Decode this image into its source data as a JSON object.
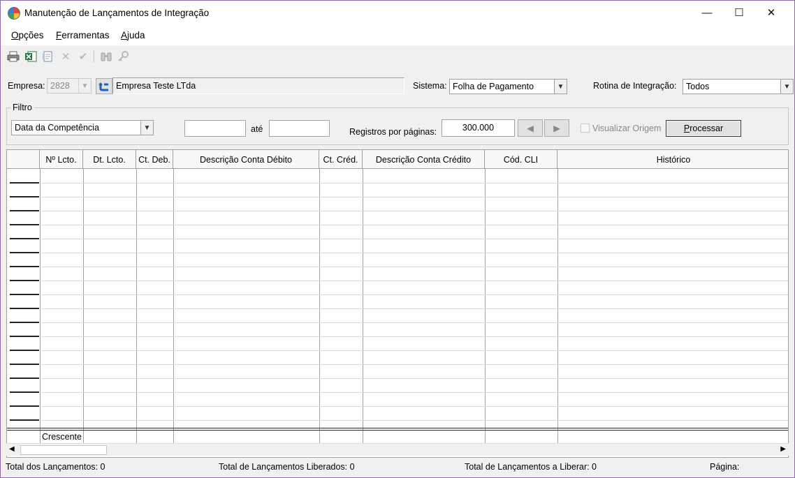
{
  "window": {
    "title": "Manutenção de Lançamentos de Integração",
    "controls": {
      "minimize": "—",
      "maximize": "☐",
      "close": "✕"
    }
  },
  "menu": [
    {
      "label": "Opções",
      "mnemonic": "O",
      "rest": "pções"
    },
    {
      "label": "Ferramentas",
      "mnemonic": "F",
      "rest": "erramentas"
    },
    {
      "label": "Ajuda",
      "mnemonic": "A",
      "rest": "juda"
    }
  ],
  "toolbar": {
    "icons": [
      "print-icon",
      "excel-export-icon",
      "document-icon",
      "delete-icon",
      "confirm-icon",
      "binoculars-icon",
      "key-icon"
    ]
  },
  "empresa": {
    "label": "Empresa:",
    "code": "2828",
    "name": "Empresa Teste LTda"
  },
  "sistema": {
    "label": "Sistema:",
    "value": "Folha de Pagamento"
  },
  "rotina": {
    "label": "Rotina de Integração:",
    "value": "Todos"
  },
  "filtro": {
    "title": "Filtro",
    "field": "Data da Competência",
    "from": "",
    "to_label": "até",
    "to": "",
    "registros_label": "Registros por páginas:",
    "registros_value": "300.000",
    "visualizar_label": "Visualizar Origem",
    "processar_label": "Processar",
    "processar_mnemonic": "P",
    "processar_rest": "rocessar"
  },
  "grid": {
    "columns": [
      "Nº Lcto.",
      "Dt. Lcto.",
      "Ct. Deb.",
      "Descrição Conta Débito",
      "Ct. Créd.",
      "Descrição Conta Crédito",
      "Cód. CLI",
      "Histórico"
    ],
    "footer_label": "Crescente"
  },
  "status": {
    "total": "Total dos Lançamentos: 0",
    "liberados": "Total de Lançamentos Liberados: 0",
    "a_liberar": "Total de Lançamentos a Liberar: 0",
    "pagina": "Página:"
  }
}
